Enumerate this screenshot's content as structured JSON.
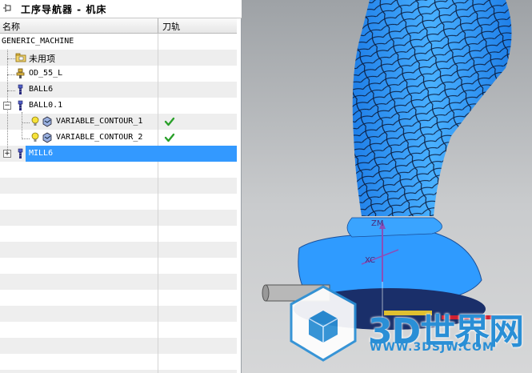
{
  "navigator": {
    "title": "工序导航器 - 机床",
    "pin_icon": "pin-icon",
    "columns": {
      "name": "名称",
      "toolpath": "刀轨"
    },
    "rows": [
      {
        "label": "GENERIC_MACHINE",
        "icon": "none",
        "toolpath": ""
      },
      {
        "label": "未用项",
        "icon": "folder-icon",
        "toolpath": ""
      },
      {
        "label": "OD_55_L",
        "icon": "tool-holder-icon",
        "toolpath": ""
      },
      {
        "label": "BALL6",
        "icon": "cutter-icon",
        "toolpath": ""
      },
      {
        "label": "BALL0.1",
        "icon": "cutter-icon",
        "toolpath": "",
        "expander": "−"
      },
      {
        "label": "VARIABLE_CONTOUR_1",
        "icon": "operation-icon",
        "toolpath": "check-icon"
      },
      {
        "label": "VARIABLE_CONTOUR_2",
        "icon": "operation-icon",
        "toolpath": "check-icon"
      },
      {
        "label": "MILL6",
        "icon": "cutter-icon",
        "toolpath": "",
        "expander": "+",
        "selected": true
      }
    ]
  },
  "viewport": {
    "axis_z": "ZM",
    "axis_label": "XC",
    "watermark_cn": "3D世界网",
    "watermark_en": "WWW.3DSJW.COM"
  },
  "colors": {
    "selection": "#3399ff",
    "model": "#2f9bff",
    "check": "#2aa02a",
    "watermark": "#2a8fd6"
  }
}
